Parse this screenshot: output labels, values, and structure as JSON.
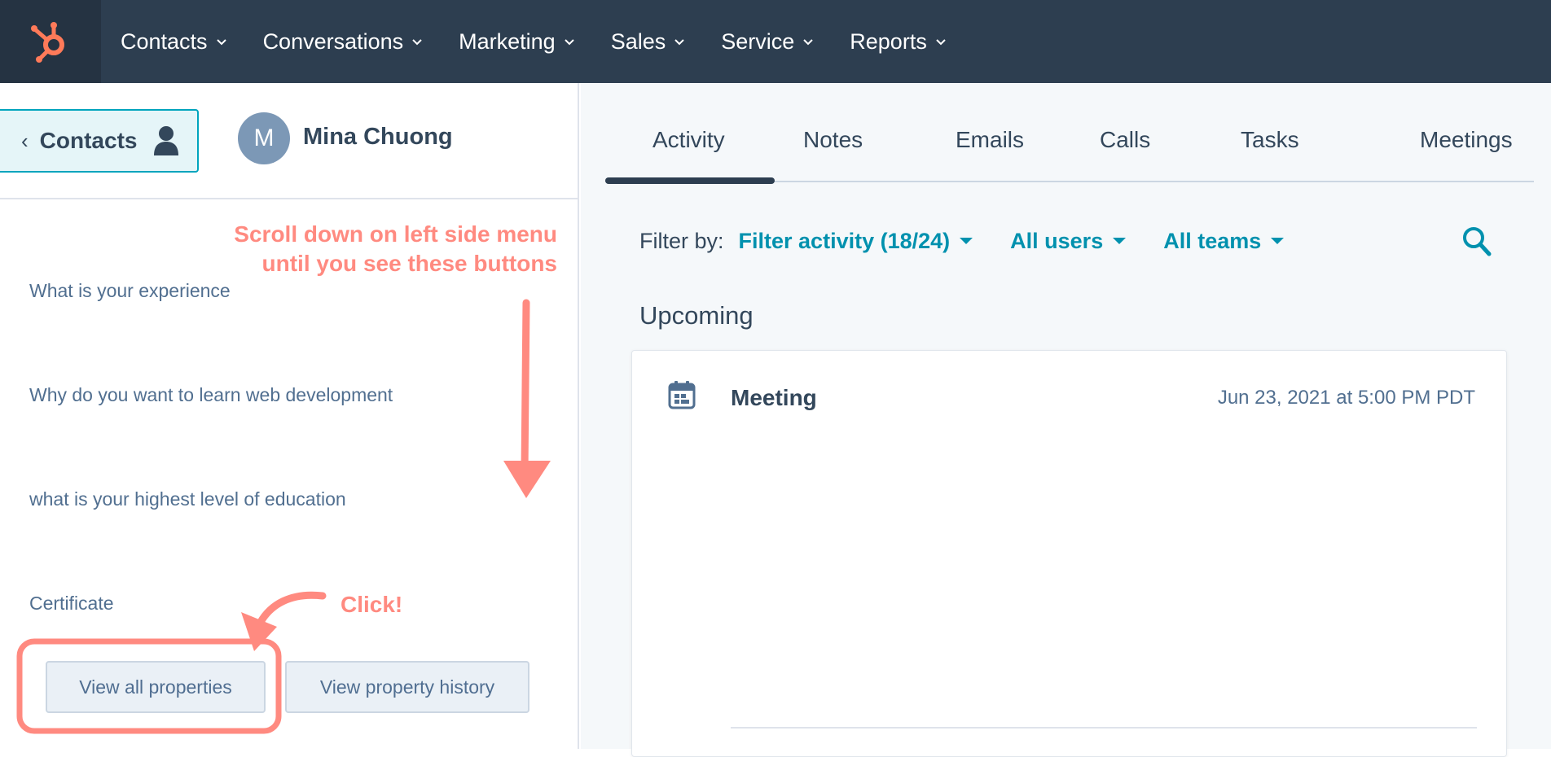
{
  "nav": {
    "items": [
      {
        "label": "Contacts"
      },
      {
        "label": "Conversations"
      },
      {
        "label": "Marketing"
      },
      {
        "label": "Sales"
      },
      {
        "label": "Service"
      },
      {
        "label": "Reports"
      }
    ]
  },
  "left": {
    "back_label": "Contacts",
    "avatar_initial": "M",
    "contact_name": "Mina Chuong",
    "properties": [
      {
        "label": "What is your experience"
      },
      {
        "label": "Why do you want to learn web development"
      },
      {
        "label": "what is your highest level of education"
      },
      {
        "label": "Certificate"
      }
    ],
    "view_all_label": "View all properties",
    "view_history_label": "View property history"
  },
  "annotations": {
    "scroll_line1": "Scroll down on left side menu",
    "scroll_line2": "until you see these buttons",
    "click": "Click!"
  },
  "right": {
    "tabs": [
      {
        "label": "Activity",
        "active": true
      },
      {
        "label": "Notes"
      },
      {
        "label": "Emails"
      },
      {
        "label": "Calls"
      },
      {
        "label": "Tasks"
      },
      {
        "label": "Meetings"
      }
    ],
    "filter": {
      "label": "Filter by:",
      "activity": "Filter activity (18/24)",
      "users": "All users",
      "teams": "All teams"
    },
    "section_title": "Upcoming",
    "card": {
      "icon": "calendar-icon",
      "title": "Meeting",
      "date": "Jun 23, 2021 at 5:00 PM PDT"
    }
  },
  "colors": {
    "nav_bg": "#2d3e50",
    "accent": "#0091ae",
    "annotation": "#ff8a80",
    "logo": "#ff7a59"
  }
}
